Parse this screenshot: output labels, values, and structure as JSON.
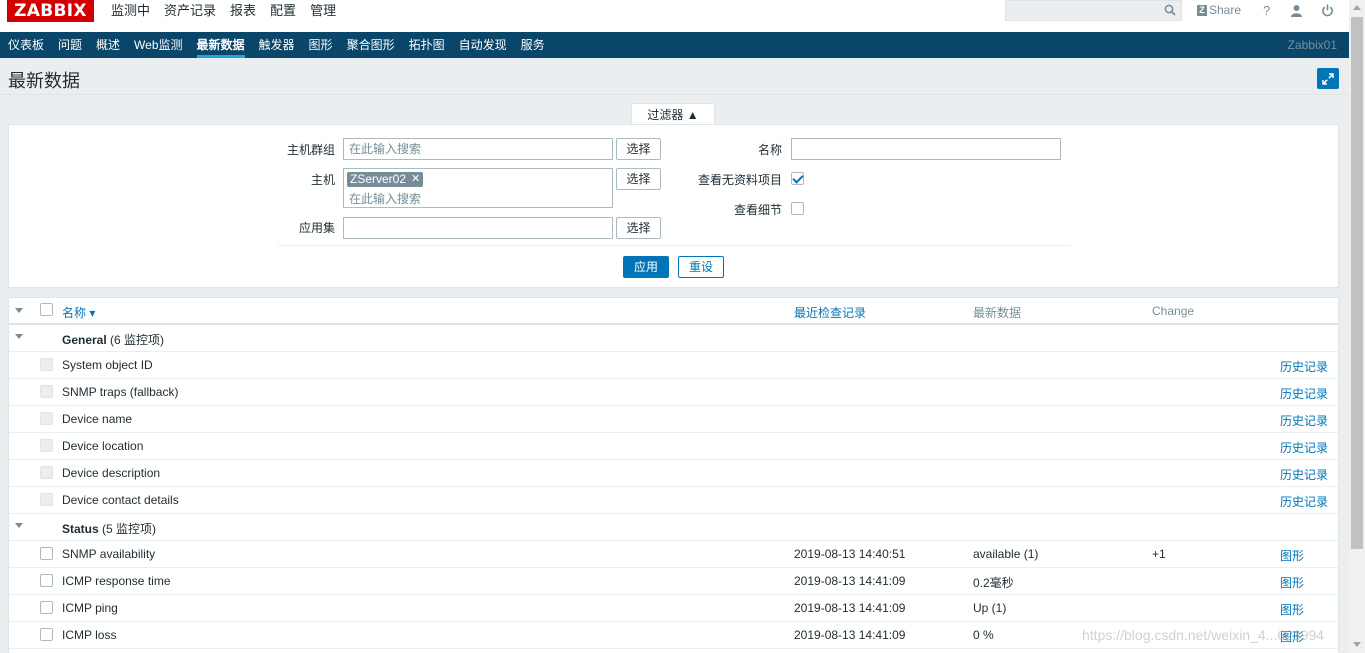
{
  "logo": "ZABBIX",
  "top_menu": [
    "监测中",
    "资产记录",
    "报表",
    "配置",
    "管理"
  ],
  "share_label": "Share",
  "help_label": "?",
  "sub_menu": [
    "仪表板",
    "问题",
    "概述",
    "Web监测",
    "最新数据",
    "触发器",
    "图形",
    "聚合图形",
    "拓扑图",
    "自动发现",
    "服务"
  ],
  "selected_sub": "最新数据",
  "server_name": "Zabbix01",
  "page_title": "最新数据",
  "filter": {
    "tab_label": "过滤器 ▲",
    "host_group_label": "主机群组",
    "host_group_placeholder": "在此输入搜索",
    "host_label": "主机",
    "host_tag": "ZServer02",
    "host_placeholder": "在此输入搜索",
    "application_label": "应用集",
    "select_label": "选择",
    "name_label": "名称",
    "show_without_data_label": "查看无资料项目",
    "show_without_data": true,
    "show_details_label": "查看细节",
    "show_details": false,
    "apply_label": "应用",
    "reset_label": "重设"
  },
  "table": {
    "headers": {
      "name": "名称 ▾",
      "last_check": "最近检查记录",
      "last_value": "最新数据",
      "change": "Change"
    },
    "groups": [
      {
        "app": "General",
        "count": "(6 监控项)",
        "items": [
          {
            "name": "System object ID",
            "last_check": "",
            "last_value": "",
            "change": "",
            "action": "历史记录",
            "disabled": true
          },
          {
            "name": "SNMP traps (fallback)",
            "last_check": "",
            "last_value": "",
            "change": "",
            "action": "历史记录",
            "disabled": true
          },
          {
            "name": "Device name",
            "last_check": "",
            "last_value": "",
            "change": "",
            "action": "历史记录",
            "disabled": true
          },
          {
            "name": "Device location",
            "last_check": "",
            "last_value": "",
            "change": "",
            "action": "历史记录",
            "disabled": true
          },
          {
            "name": "Device description",
            "last_check": "",
            "last_value": "",
            "change": "",
            "action": "历史记录",
            "disabled": true
          },
          {
            "name": "Device contact details",
            "last_check": "",
            "last_value": "",
            "change": "",
            "action": "历史记录",
            "disabled": true
          }
        ]
      },
      {
        "app": "Status",
        "count": "(5 监控项)",
        "items": [
          {
            "name": "SNMP availability",
            "last_check": "2019-08-13 14:40:51",
            "last_value": "available (1)",
            "change": "+1",
            "action": "图形",
            "disabled": false
          },
          {
            "name": "ICMP response time",
            "last_check": "2019-08-13 14:41:09",
            "last_value": "0.2毫秒",
            "change": "",
            "action": "图形",
            "disabled": false
          },
          {
            "name": "ICMP ping",
            "last_check": "2019-08-13 14:41:09",
            "last_value": "Up (1)",
            "change": "",
            "action": "图形",
            "disabled": false
          },
          {
            "name": "ICMP loss",
            "last_check": "2019-08-13 14:41:09",
            "last_value": "0 %",
            "change": "",
            "action": "图形",
            "disabled": false
          }
        ]
      }
    ]
  },
  "watermark": "https://blog.csdn.net/weixin_4...623994"
}
